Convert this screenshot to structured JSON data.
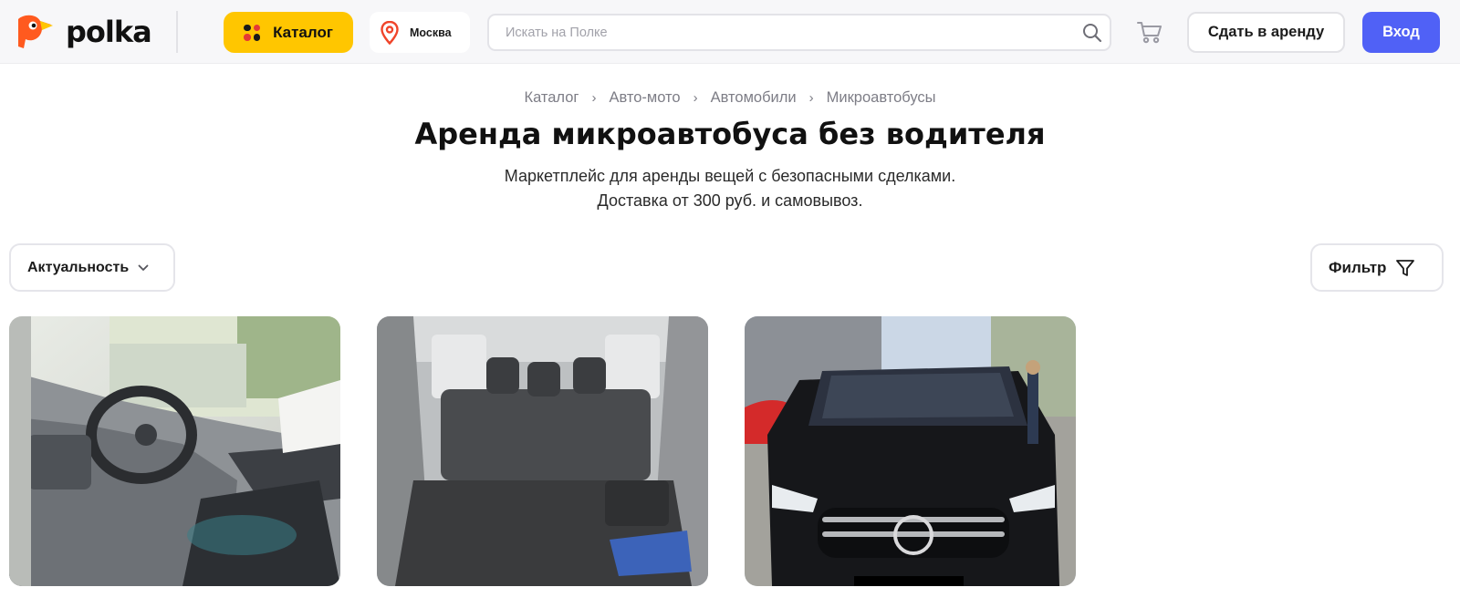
{
  "header": {
    "logo_text": "polka",
    "catalog_label": "Каталог",
    "city": "Москва",
    "search_placeholder": "Искать на Полке",
    "rent_out_label": "Сдать в аренду",
    "login_label": "Вход"
  },
  "breadcrumbs": [
    "Каталог",
    "Авто-мото",
    "Автомобили",
    "Микроавтобусы"
  ],
  "page": {
    "title": "Аренда микроавтобуса без водителя",
    "subtitle_line1": "Маркетплейс для аренды вещей с безопасными сделками.",
    "subtitle_line2": "Доставка от 300 руб. и самовывоз."
  },
  "controls": {
    "sort_label": "Актуальность",
    "filter_label": "Фильтр"
  },
  "colors": {
    "accent_yellow": "#ffc600",
    "accent_blue": "#5061f6",
    "header_bg": "#f7f7f9"
  },
  "icons": [
    "logo-mark",
    "grid-icon",
    "location-pin-icon",
    "search-icon",
    "cart-icon",
    "chevron-down-icon",
    "filter-funnel-icon",
    "chevron-right-icon"
  ]
}
